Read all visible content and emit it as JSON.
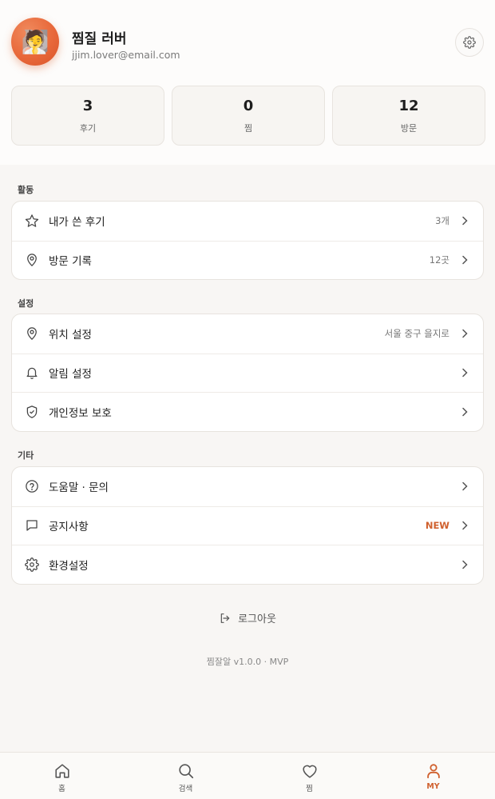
{
  "profile": {
    "avatar_emoji": "🧖",
    "name": "찜질 러버",
    "email": "jjim.lover@email.com"
  },
  "stats": [
    {
      "value": "3",
      "label": "후기"
    },
    {
      "value": "0",
      "label": "찜"
    },
    {
      "value": "12",
      "label": "방문"
    }
  ],
  "sections": {
    "activity": {
      "title": "활동",
      "items": [
        {
          "label": "내가 쓴 후기",
          "value": "3개",
          "icon": "star-icon"
        },
        {
          "label": "방문 기록",
          "value": "12곳",
          "icon": "map-pin-icon"
        }
      ]
    },
    "settings": {
      "title": "설정",
      "items": [
        {
          "label": "위치 설정",
          "value": "서울 중구 을지로",
          "icon": "map-pin-icon"
        },
        {
          "label": "알림 설정",
          "value": "",
          "icon": "bell-icon"
        },
        {
          "label": "개인정보 보호",
          "value": "",
          "icon": "shield-icon"
        }
      ]
    },
    "etc": {
      "title": "기타",
      "items": [
        {
          "label": "도움말 · 문의",
          "value": "",
          "icon": "help-circle-icon"
        },
        {
          "label": "공지사항",
          "value": "NEW",
          "icon": "message-square-icon"
        },
        {
          "label": "환경설정",
          "value": "",
          "icon": "gear-icon"
        }
      ]
    }
  },
  "logout_label": "로그아웃",
  "version": "찜잘알 v1.0.0 · MVP",
  "nav": [
    {
      "label": "홈",
      "icon": "home-icon",
      "active": false
    },
    {
      "label": "검색",
      "icon": "search-icon",
      "active": false
    },
    {
      "label": "찜",
      "icon": "heart-icon",
      "active": false
    },
    {
      "label": "MY",
      "icon": "user-icon",
      "active": true
    }
  ],
  "colors": {
    "accent": "#d0612f",
    "background": "#f8f6f4",
    "card": "#ffffff"
  }
}
